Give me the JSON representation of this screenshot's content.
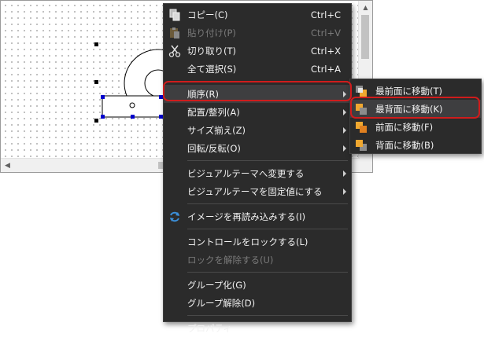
{
  "context_menu": {
    "items": [
      {
        "label": "コピー(C)",
        "shortcut": "Ctrl+C",
        "icon": "copy-icon"
      },
      {
        "label": "貼り付け(P)",
        "shortcut": "Ctrl+V",
        "icon": "paste-icon",
        "disabled": true
      },
      {
        "label": "切り取り(T)",
        "shortcut": "Ctrl+X",
        "icon": "cut-icon"
      },
      {
        "label": "全て選択(S)",
        "shortcut": "Ctrl+A"
      },
      {
        "label": "順序(R)",
        "submenu": true,
        "highlighted": true
      },
      {
        "label": "配置/整列(A)",
        "submenu": true
      },
      {
        "label": "サイズ揃え(Z)",
        "submenu": true
      },
      {
        "label": "回転/反転(O)",
        "submenu": true
      },
      {
        "label": "ビジュアルテーマへ変更する",
        "submenu": true
      },
      {
        "label": "ビジュアルテーマを固定値にする",
        "submenu": true
      },
      {
        "label": "イメージを再読み込みする(I)",
        "icon": "refresh-icon"
      },
      {
        "label": "コントロールをロックする(L)"
      },
      {
        "label": "ロックを解除する(U)",
        "disabled": true
      },
      {
        "label": "グループ化(G)"
      },
      {
        "label": "グループ解除(D)"
      },
      {
        "label": "プロパティ"
      }
    ]
  },
  "order_submenu": {
    "items": [
      {
        "label": "最前面に移動(T)",
        "icon": "bring-to-front-icon"
      },
      {
        "label": "最背面に移動(K)",
        "icon": "send-to-back-icon",
        "highlighted": true
      },
      {
        "label": "前面に移動(F)",
        "icon": "bring-forward-icon"
      },
      {
        "label": "背面に移動(B)",
        "icon": "send-backward-icon"
      }
    ]
  },
  "colors": {
    "menu_background": "#2b2b2b",
    "menu_text": "#f1f1f1",
    "disabled_text": "#7a7a7a",
    "highlight_border": "#d01c1c",
    "selection_handle": "#0000cc"
  }
}
